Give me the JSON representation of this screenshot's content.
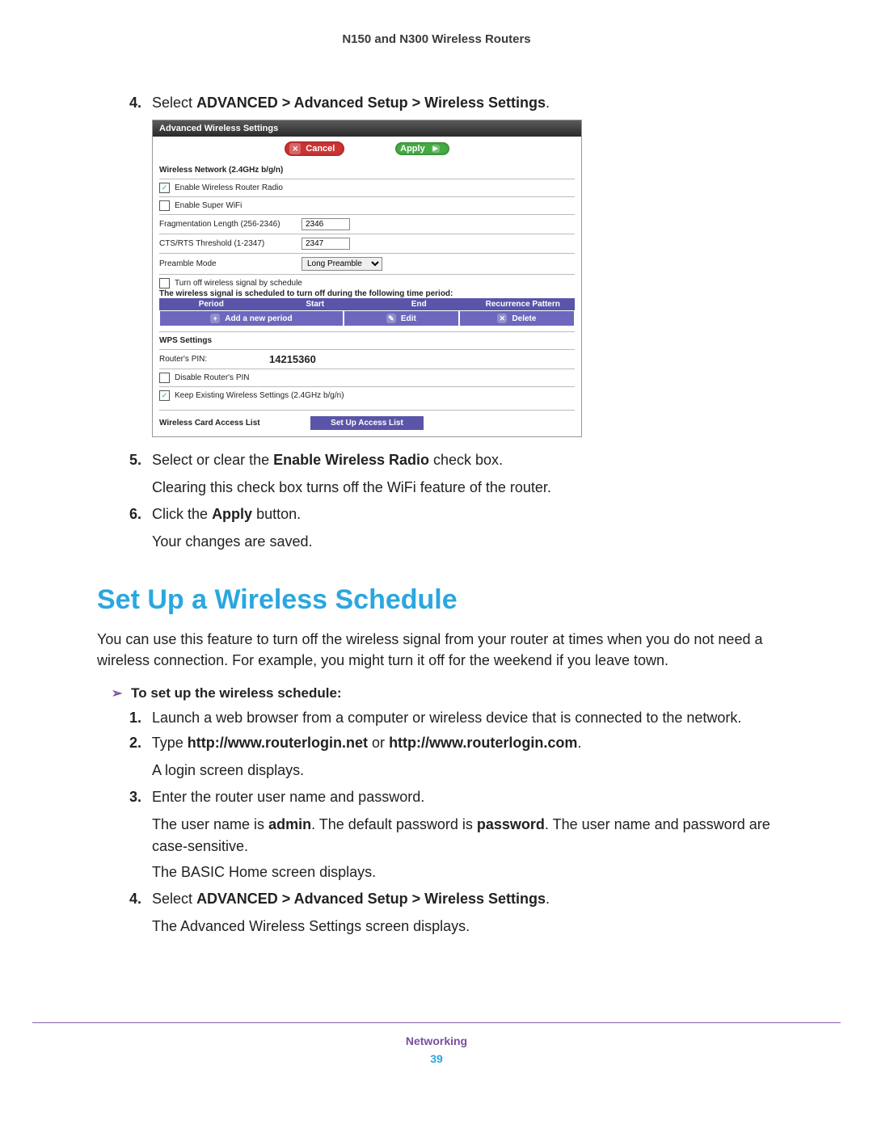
{
  "doc_header": "N150 and N300 Wireless Routers",
  "step4": {
    "num": "4.",
    "pre": "Select ",
    "path": "ADVANCED > Advanced Setup > Wireless Settings",
    "post": "."
  },
  "screenshot": {
    "title": "Advanced Wireless Settings",
    "cancel": "Cancel",
    "apply": "Apply",
    "net_title": "Wireless Network (2.4GHz b/g/n)",
    "cb_enable_radio": "Enable Wireless Router Radio",
    "cb_super_wifi": "Enable Super WiFi",
    "frag_label": "Fragmentation Length (256-2346)",
    "frag_val": "2346",
    "cts_label": "CTS/RTS Threshold (1-2347)",
    "cts_val": "2347",
    "preamble_label": "Preamble Mode",
    "preamble_val": "Long Preamble",
    "cb_schedule": "Turn off wireless signal by schedule",
    "schedule_note": "The wireless signal is scheduled to turn off during the following time period:",
    "sched_cols": {
      "period": "Period",
      "start": "Start",
      "end": "End",
      "recur": "Recurrence Pattern"
    },
    "sched_btns": {
      "add": "Add a new period",
      "edit": "Edit",
      "delete": "Delete"
    },
    "wps_title": "WPS Settings",
    "router_pin_label": "Router's PIN:",
    "router_pin_val": "14215360",
    "cb_disable_pin": "Disable Router's PIN",
    "cb_keep_settings": "Keep Existing Wireless Settings (2.4GHz b/g/n)",
    "wcal_title": "Wireless Card Access List",
    "wcal_btn": "Set Up Access List"
  },
  "step5": {
    "num": "5.",
    "pre": "Select or clear the ",
    "bold": "Enable Wireless Radio",
    "post": " check box.",
    "line2": "Clearing this check box turns off the WiFi feature of the router."
  },
  "step6": {
    "num": "6.",
    "pre": "Click the ",
    "bold": "Apply",
    "post": " button.",
    "line2": "Your changes are saved."
  },
  "heading": "Set Up a Wireless Schedule",
  "intro": "You can use this feature to turn off the wireless signal from your router at times when you do not need a wireless connection. For example, you might turn it off for the weekend if you leave town.",
  "proc_head": "To set up the wireless schedule:",
  "p1": {
    "num": "1.",
    "text": "Launch a web browser from a computer or wireless device that is connected to the network."
  },
  "p2": {
    "num": "2.",
    "pre": "Type ",
    "b1": "http://www.routerlogin.net",
    "mid": " or ",
    "b2": "http://www.routerlogin.com",
    "post": ".",
    "line2": "A login screen displays."
  },
  "p3": {
    "num": "3.",
    "text": "Enter the router user name and password.",
    "line2a": "The user name is ",
    "b1": "admin",
    "line2b": ". The default password is ",
    "b2": "password",
    "line2c": ". The user name and password are case-sensitive.",
    "line3": "The BASIC Home screen displays."
  },
  "p4": {
    "num": "4.",
    "pre": "Select ",
    "path": "ADVANCED > Advanced Setup > Wireless Settings",
    "post": ".",
    "line2": "The Advanced Wireless Settings screen displays."
  },
  "footer_section": "Networking",
  "footer_page": "39"
}
